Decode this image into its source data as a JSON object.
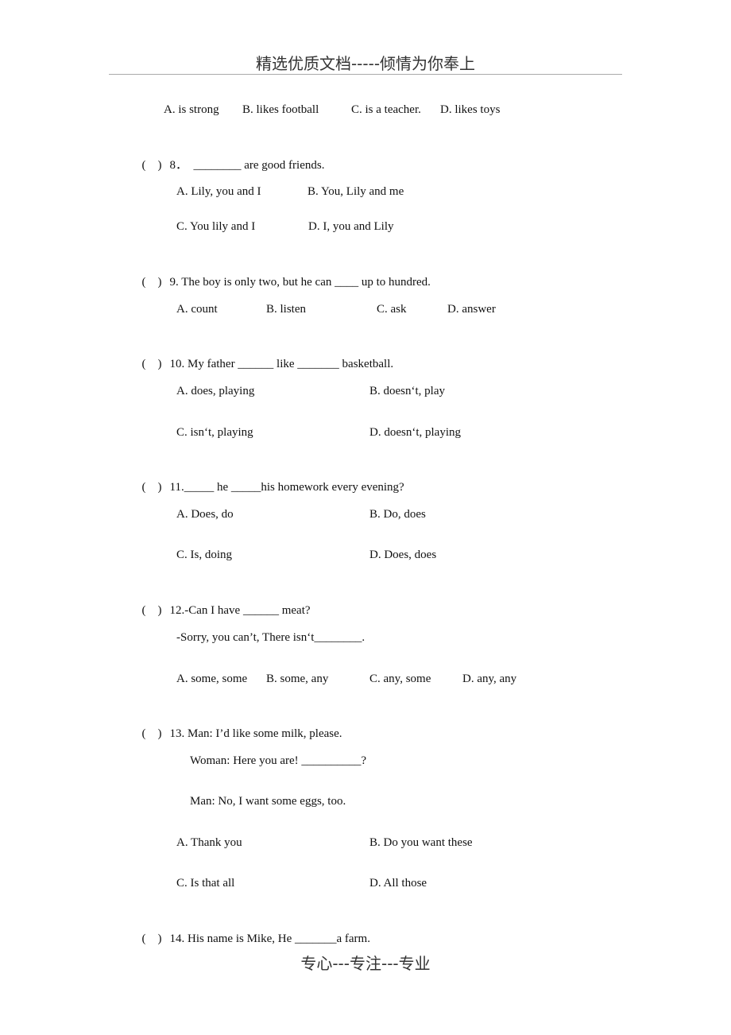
{
  "header": {
    "text": "精选优质文档-----倾情为你奉上"
  },
  "footer": {
    "text": "专心---专注---专业"
  },
  "q7_options": {
    "a": "A. is strong",
    "b": "B. likes football",
    "c": "C. is a teacher.",
    "d": "D. likes toys"
  },
  "questions": [
    {
      "paren": "(    )",
      "stem": "8．  ________ are good friends.",
      "options": [
        "A. Lily, you and I",
        "B. You, Lily and me",
        "C. You lily and I",
        "D. I, you and Lily"
      ]
    },
    {
      "paren": "(    )",
      "stem": "9. The boy is only two, but he can ____ up to hundred.",
      "options": [
        "A. count",
        "B. listen",
        "C. ask",
        "D. answer"
      ]
    },
    {
      "paren": "(    )",
      "stem": "10. My father ______ like _______ basketball.",
      "options": [
        "A. does, playing",
        "B. doesn‘t, play",
        "C. isn‘t, playing",
        "D. doesn‘t, playing"
      ]
    },
    {
      "paren": "(    )",
      "stem": "11._____ he _____his homework every evening?",
      "options": [
        "A. Does, do",
        "B. Do, does",
        "C. Is, doing",
        "D. Does, does"
      ]
    },
    {
      "paren": "(    )",
      "stem": "12.-Can I have ______ meat?",
      "reply": "-Sorry, you can’t, There isn‘t________.",
      "options": [
        "A. some, some",
        "B. some, any",
        "C. any, some",
        "D. any, any"
      ]
    },
    {
      "paren": "(    )",
      "stem": "13. Man: I’d like some milk, please.",
      "dialogue": [
        "Woman: Here you are! __________?",
        "Man: No, I want some eggs, too."
      ],
      "options": [
        "A. Thank you",
        "B. Do you want these",
        "C. Is that all",
        "D. All those"
      ]
    },
    {
      "paren": "(    )",
      "stem": "14. His name is Mike, He _______a farm."
    }
  ]
}
